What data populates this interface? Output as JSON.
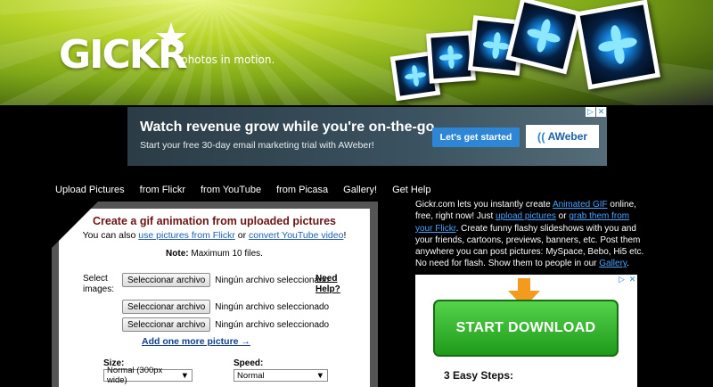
{
  "brand": {
    "logo_text": "GICKR",
    "tagline": "photos in motion."
  },
  "top_ad": {
    "headline": "Watch revenue grow while you're on-the-go.",
    "subtext": "Start your free 30-day email marketing trial with AWeber!",
    "cta_label": "Let's get started",
    "brand_name": "AWeber",
    "adchoices_icon": "adchoices-icon",
    "close_glyph": "✕"
  },
  "nav": [
    "Upload Pictures",
    "from Flickr",
    "from YouTube",
    "from Picasa",
    "Gallery!",
    "Get Help"
  ],
  "panel": {
    "title": "Create a gif animation from uploaded pictures",
    "subtitle_prefix": "You can also ",
    "link_flickr": "use pictures from Flickr",
    "subtitle_or": " or ",
    "link_youtube": "convert YouTube video",
    "subtitle_suffix": "!",
    "note_label": "Note:",
    "note_text": " Maximum 10 files.",
    "select_label": "Select images:",
    "file_button_label": "Seleccionar archivo",
    "file_status": "Ningún archivo seleccionado",
    "need_help": "Need Help?",
    "add_more": "Add one more picture →",
    "size_label": "Size:",
    "size_value": "Normal (300px wide)",
    "speed_label": "Speed:",
    "speed_value": "Normal"
  },
  "intro": {
    "t1": "Gickr.com lets you instantly create ",
    "l1": "Animated GIF",
    "t2": " online, free, right now! Just ",
    "l2": "upload pictures",
    "t3": " or ",
    "l3": "grab them from your Flickr",
    "t4": ". Create funny flashy slideshows with you and your friends, cartoons, previews, banners, etc. Post them anywhere you can post pictures: MySpace, Bebo, Hi5 etc. No need for flash. Show them to people in our ",
    "l4": "Gallery",
    "t5": "."
  },
  "side_ad": {
    "button_label": "START DOWNLOAD",
    "steps_title": "3 Easy Steps:"
  },
  "colors": {
    "link": "#1a5fb4",
    "panel_title": "#6b1414",
    "download_green": "#2bb027"
  }
}
